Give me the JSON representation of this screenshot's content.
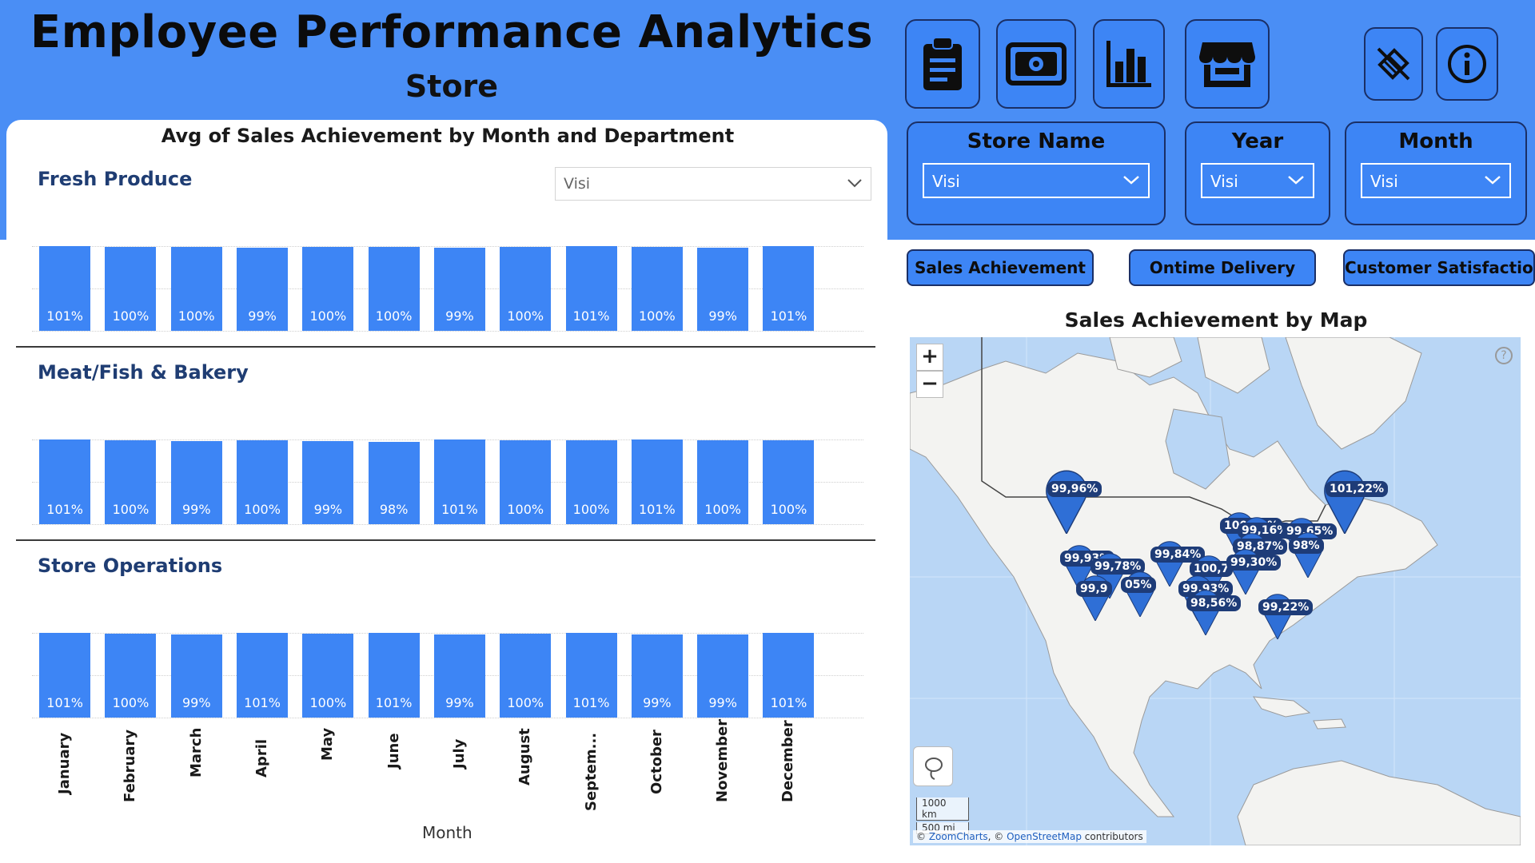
{
  "header": {
    "title": "Employee Performance Analytics",
    "subtitle": "Store"
  },
  "nav_icons": [
    "clipboard-icon",
    "cash-icon",
    "bar-chart-icon",
    "store-icon",
    "clear-filters-icon",
    "info-icon"
  ],
  "chart": {
    "title": "Avg of Sales Achievement by Month and Department",
    "dropdown_value": "Visi",
    "x_axis_title": "Month"
  },
  "chart_data": {
    "type": "bar",
    "title": "Avg of Sales Achievement by Month and Department",
    "xlabel": "Month",
    "categories": [
      "January",
      "February",
      "March",
      "April",
      "May",
      "June",
      "July",
      "August",
      "Septem...",
      "October",
      "November",
      "December"
    ],
    "series": [
      {
        "name": "Fresh Produce",
        "values": [
          101,
          100,
          100,
          99,
          100,
          100,
          99,
          100,
          101,
          100,
          99,
          101
        ],
        "labels": [
          "101%",
          "100%",
          "100%",
          "99%",
          "100%",
          "100%",
          "99%",
          "100%",
          "101%",
          "100%",
          "99%",
          "101%"
        ]
      },
      {
        "name": "Meat/Fish & Bakery",
        "values": [
          101,
          100,
          99,
          100,
          99,
          98,
          101,
          100,
          100,
          101,
          100,
          100
        ],
        "labels": [
          "101%",
          "100%",
          "99%",
          "100%",
          "99%",
          "98%",
          "101%",
          "100%",
          "100%",
          "101%",
          "100%",
          "100%"
        ]
      },
      {
        "name": "Store Operations",
        "values": [
          101,
          100,
          99,
          101,
          100,
          101,
          99,
          100,
          101,
          99,
          99,
          101
        ],
        "labels": [
          "101%",
          "100%",
          "99%",
          "101%",
          "100%",
          "101%",
          "99%",
          "100%",
          "101%",
          "99%",
          "99%",
          "101%"
        ]
      }
    ]
  },
  "slicers": [
    {
      "title": "Store Name",
      "value": "Visi"
    },
    {
      "title": "Year",
      "value": "Visi"
    },
    {
      "title": "Month",
      "value": "Visi"
    }
  ],
  "pills": [
    "Sales Achievement",
    "Ontime Delivery",
    "Customer Satisfaction"
  ],
  "map": {
    "title": "Sales Achievement by Map",
    "zoom_in": "+",
    "zoom_out": "−",
    "help": "?",
    "scale_km": "1000 km",
    "scale_mi": "500 mi",
    "attribution_prefix": "© ",
    "attribution_zoom": "ZoomCharts",
    "attribution_mid": ", © ",
    "attribution_osm": "OpenStreetMap",
    "attribution_suffix": " contributors",
    "pins": [
      "99,96%",
      "101,22%",
      "100,10%",
      "99,16%",
      "99,65%",
      "98,87%",
      "98%",
      "99,84%",
      "99,93%",
      "99,78%",
      "05%",
      "100,7",
      "99,30%",
      "99,93%",
      "98,56%",
      "99,22%",
      "99,9"
    ]
  },
  "colors": {
    "band": "#4a8ef5",
    "bar": "#3d85f5",
    "pin": "#1e3c78",
    "border": "#1a2f66"
  }
}
